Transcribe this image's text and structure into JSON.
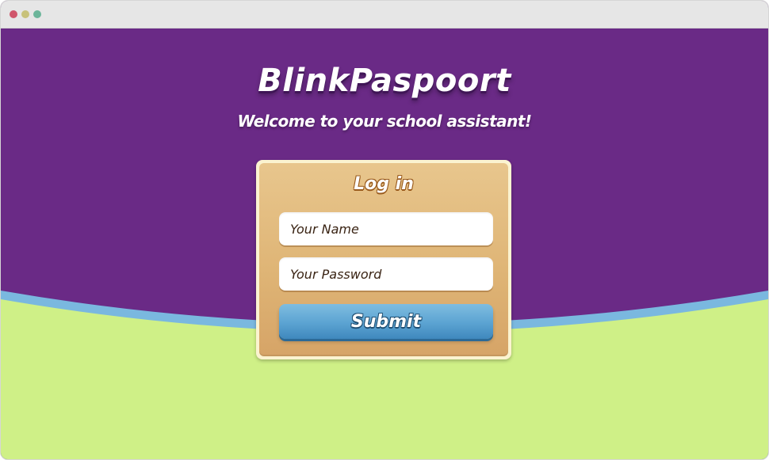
{
  "app": {
    "brand": "BlinkPaspoort",
    "tagline": "Welcome to your school assistant!"
  },
  "login": {
    "title": "Log in",
    "name_placeholder": "Your Name",
    "password_placeholder": "Your Password",
    "submit_label": "Submit"
  },
  "colors": {
    "sky": "#6a2a86",
    "horizon": "#7ab8df",
    "ground": "#cff087",
    "card_frame": "#fbf3d0",
    "card_fill": "#dfb576",
    "button": "#5ba3d2"
  }
}
